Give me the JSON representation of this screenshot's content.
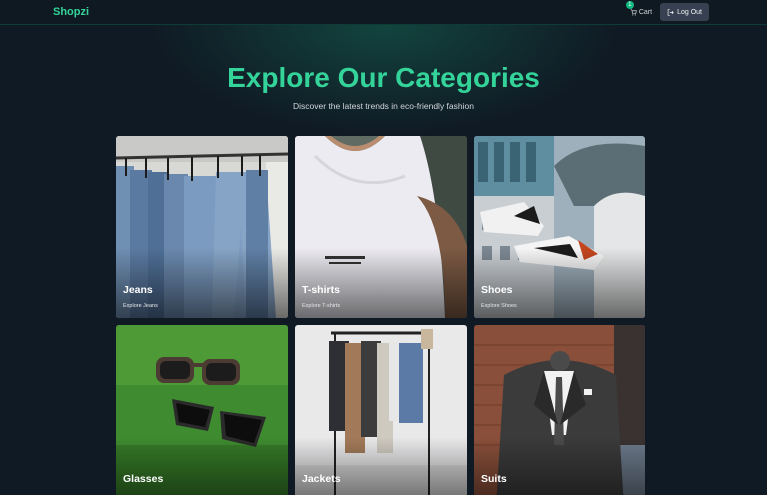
{
  "navbar": {
    "brand": "Shopzi",
    "cart_label": "Cart",
    "cart_count": "1",
    "logout_label": "Log Out"
  },
  "hero": {
    "title": "Explore Our Categories",
    "subtitle": "Discover the latest trends in eco-friendly fashion"
  },
  "categories": [
    {
      "name": "Jeans",
      "description": "Explore Jeans",
      "image": "jeans-on-rack-photo"
    },
    {
      "name": "T-shirts",
      "description": "Explore T-shirts",
      "image": "white-tshirt-photo"
    },
    {
      "name": "Shoes",
      "description": "Explore Shoes",
      "image": "sneakers-photo"
    },
    {
      "name": "Glasses",
      "description": "",
      "image": "sunglasses-on-grass-photo"
    },
    {
      "name": "Jackets",
      "description": "",
      "image": "jackets-on-rack-photo"
    },
    {
      "name": "Suits",
      "description": "",
      "image": "suit-mannequin-photo"
    }
  ],
  "colors": {
    "accent": "#34d399",
    "background": "#101a24",
    "button": "#374151"
  }
}
